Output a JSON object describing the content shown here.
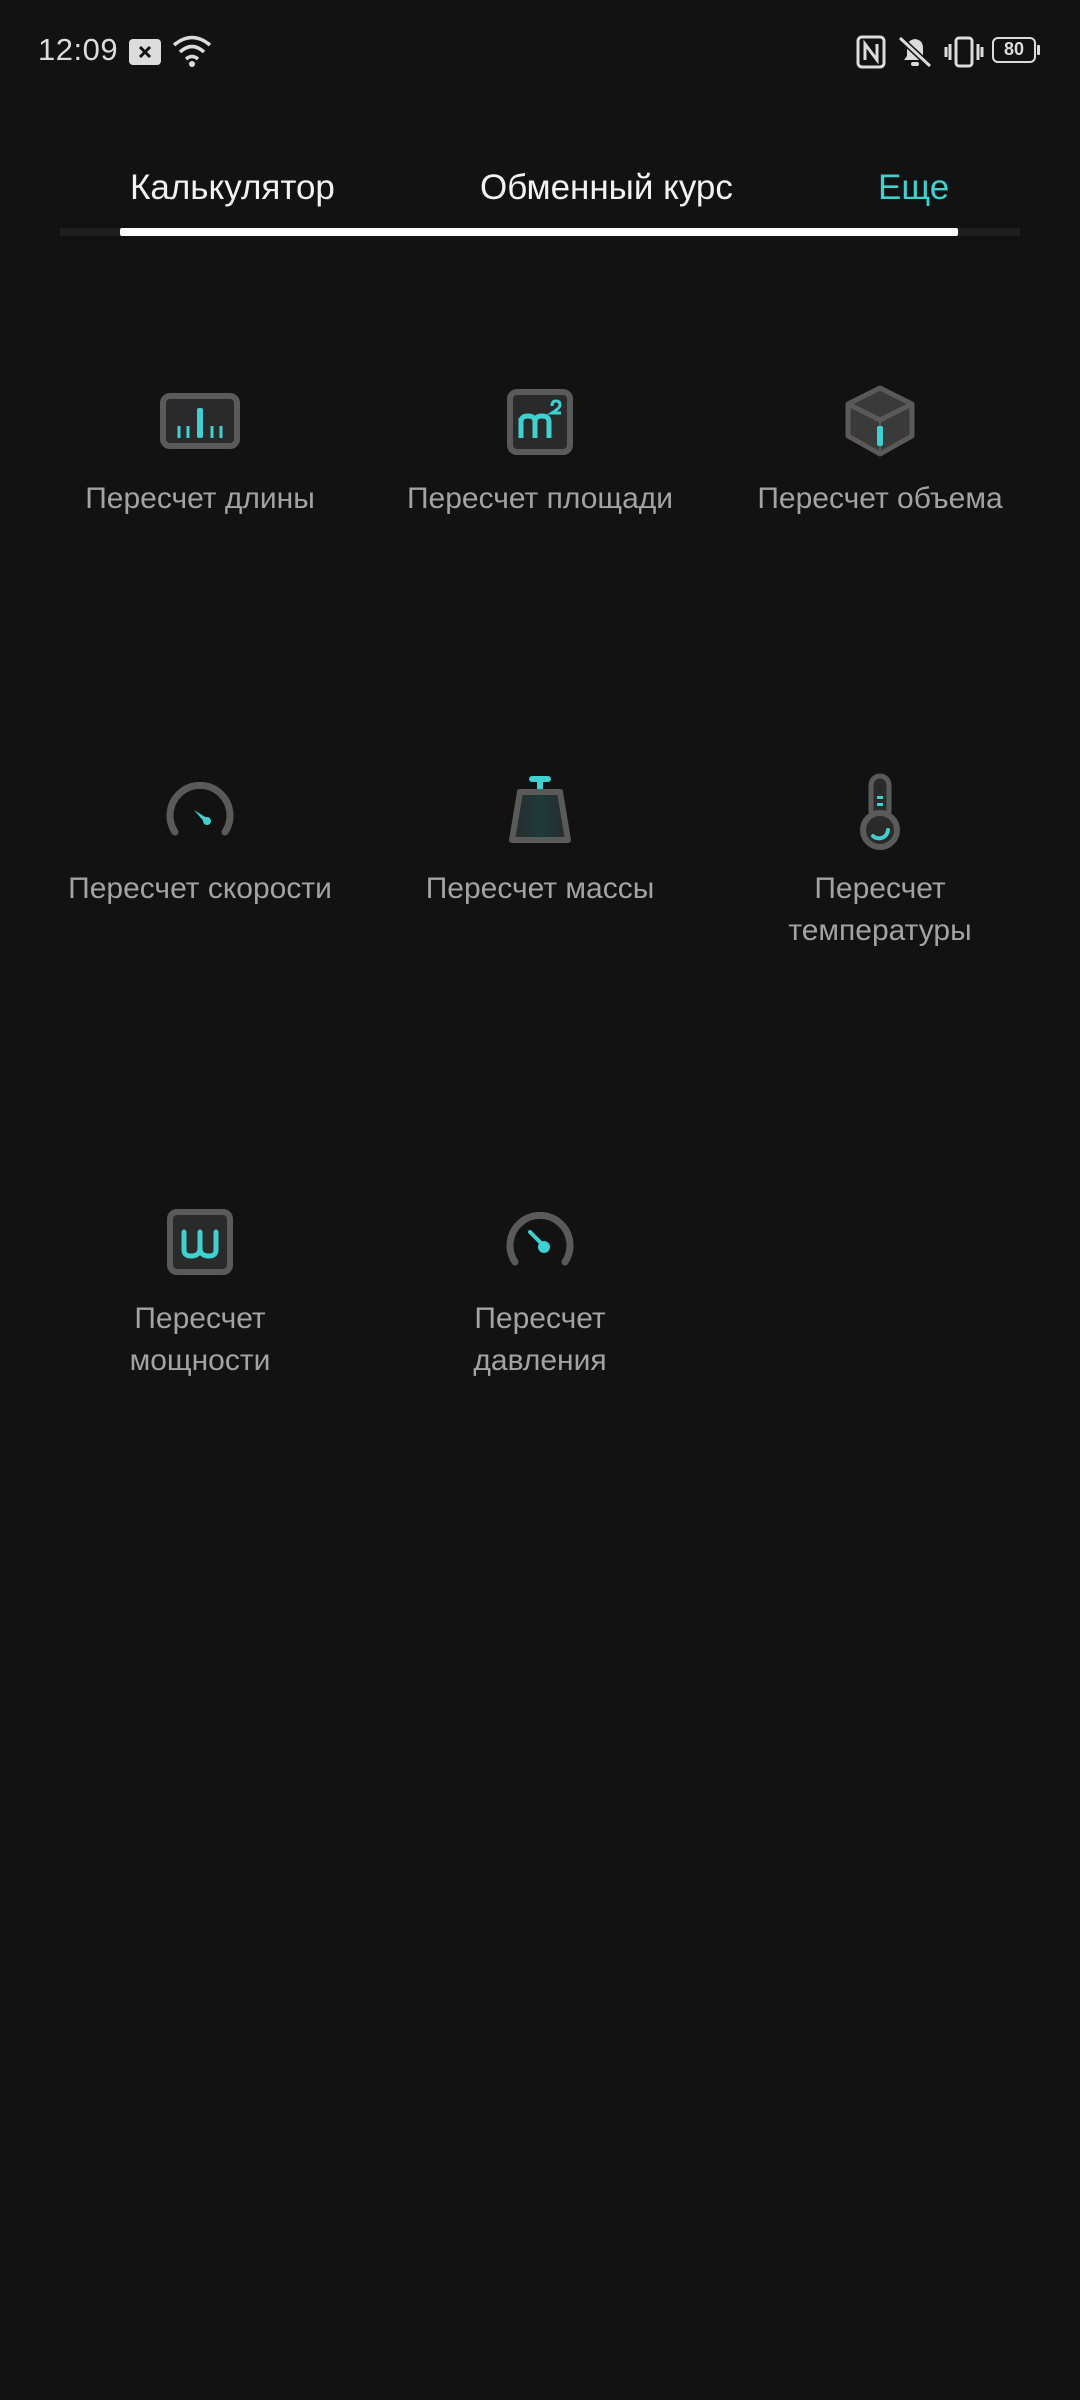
{
  "status_bar": {
    "time": "12:09",
    "battery": "80",
    "icons": [
      "notification-x-icon",
      "wifi-icon",
      "nfc-icon",
      "mute-icon",
      "vibrate-icon",
      "battery-icon"
    ]
  },
  "tabs": [
    {
      "label": "Калькулятор",
      "active": false
    },
    {
      "label": "Обменный курс",
      "active": false
    },
    {
      "label": "Еще",
      "active": true
    }
  ],
  "colors": {
    "background": "#121212",
    "accent": "#3fd0cf",
    "icon_gray": "#5a5a5a",
    "label_gray": "#a3a3a3"
  },
  "converters": [
    {
      "label": "Пересчет длины",
      "icon": "length-ruler-icon"
    },
    {
      "label": "Пересчет площади",
      "icon": "area-m2-icon"
    },
    {
      "label": "Пересчет объема",
      "icon": "volume-cube-icon"
    },
    {
      "label": "Пересчет скорости",
      "icon": "speed-gauge-icon"
    },
    {
      "label": "Пересчет массы",
      "icon": "mass-weight-icon"
    },
    {
      "label": "Пересчет\nтемпературы",
      "icon": "temperature-thermometer-icon"
    },
    {
      "label": "Пересчет\nмощности",
      "icon": "power-watt-icon"
    },
    {
      "label": "Пересчет\nдавления",
      "icon": "pressure-gauge-icon"
    }
  ]
}
